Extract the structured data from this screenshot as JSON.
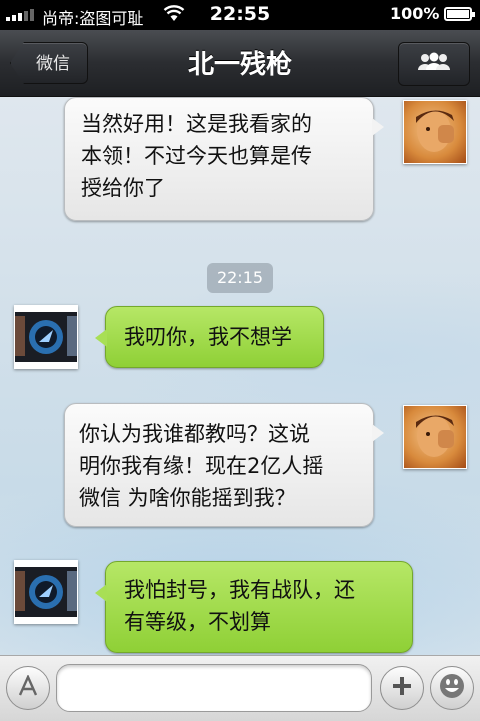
{
  "status_bar": {
    "carrier": "尚帝:盗图可耻",
    "time": "22:55",
    "battery": "100%"
  },
  "nav": {
    "back_label": "微信",
    "title": "北一残枪",
    "contacts_icon": "group-icon"
  },
  "messages": [
    {
      "side": "right",
      "text": "当然好用！这是我看家的\n本领！不过今天也算是传\n授给你了"
    },
    {
      "side": "timestamp",
      "text": "22:15"
    },
    {
      "side": "left",
      "text": "我叨你，我不想学"
    },
    {
      "side": "right",
      "text": "你认为我谁都教吗？这说\n明你我有缘！现在2亿人摇\n微信 为啥你能摇到我？"
    },
    {
      "side": "left",
      "text": "我怕封号，我有战队，还\n有等级，不划算"
    }
  ],
  "input_bar": {
    "voice_icon": "text-mode-icon",
    "input_value": "",
    "plus_icon": "plus-icon",
    "emoji_icon": "smiley-icon"
  },
  "colors": {
    "sent_bubble": "#f0f0f0",
    "received_bubble": "#a5dd50",
    "nav_bg": "#2b2d31"
  }
}
